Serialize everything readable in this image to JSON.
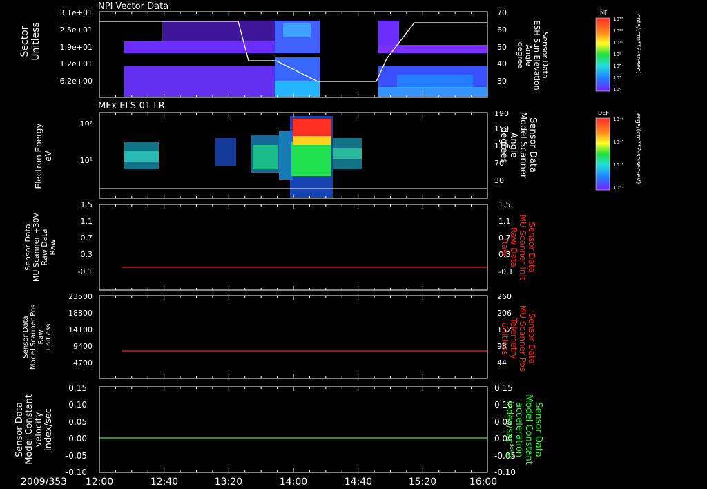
{
  "colors": {
    "white": "#ffffff",
    "red": "#ff2020",
    "green": "#30ff30",
    "bg": "#000000"
  },
  "date_label": "2009/353",
  "time_ticks": [
    "12:00",
    "12:40",
    "13:20",
    "14:00",
    "14:40",
    "15:20",
    "16:00"
  ],
  "chart_data": [
    {
      "type": "heatmap",
      "title": "NPI Vector Data",
      "ylabel": [
        "Sector",
        "Unitless"
      ],
      "y_tick_labels": [
        "3.1e+01",
        "2.5e+01",
        "1.9e+01",
        "1.2e+01",
        "6.2e+00"
      ],
      "right_axis": {
        "label": [
          "Sensor Data",
          "ESH Sun Elevation",
          "Angle",
          "degree"
        ],
        "ticks": [
          70,
          60,
          50,
          40,
          30
        ],
        "ylim": [
          20,
          70
        ]
      },
      "line": {
        "name": "ESH Sun Elevation Angle",
        "x": [
          "12:00",
          "13:10",
          "13:25",
          "13:40",
          "14:10",
          "14:45",
          "15:05",
          "15:20",
          "16:00"
        ],
        "y": [
          66,
          66,
          41,
          41,
          29,
          29,
          40,
          65,
          65
        ]
      },
      "colorbar": {
        "label": "NF",
        "units": "cnts/(cm**2-sr-sec)",
        "ticks": [
          "10¹²",
          "10¹¹",
          "10¹⁰",
          "10⁹",
          "10⁸",
          "10⁷",
          "10⁶"
        ]
      }
    },
    {
      "type": "heatmap",
      "title": "MEx ELS-01 LR",
      "ylabel": [
        "Electron Energy",
        "eV"
      ],
      "y_tick_labels": [
        "10²",
        "10¹"
      ],
      "right_axis": {
        "label": [
          "Sensor Data",
          "Model Scanner",
          "Angle",
          "degrees"
        ],
        "ticks": [
          190,
          150,
          110,
          70,
          30
        ]
      },
      "line": {
        "name": "Model Scanner Angle",
        "x": [
          "12:00",
          "16:00"
        ],
        "y": [
          12,
          12
        ]
      },
      "colorbar": {
        "label": "DEF",
        "units": "ergs/(cm**2-sr-sec-eV)",
        "ticks": [
          "10⁻⁴",
          "10⁻⁵",
          "10⁻⁶",
          "10⁻⁷"
        ]
      }
    },
    {
      "type": "line",
      "ylabel": [
        "Sensor Data",
        "MU Scanner +30V",
        "Raw Data",
        "Raw"
      ],
      "y_ticks": [
        "1.5",
        "1.1",
        "0.7",
        "0.3",
        "-0.1"
      ],
      "ylim": [
        -0.5,
        1.5
      ],
      "right_axis": {
        "label": [
          "Sensor Data",
          "MU Scanner Init",
          "Raw Data",
          "Raw"
        ],
        "ticks": [
          "1.5",
          "1.1",
          "0.7",
          "0.3",
          "-0.1"
        ],
        "color": "#ff2020"
      },
      "series": [
        {
          "color": "#ff2020",
          "x": [
            "12:30",
            "16:00"
          ],
          "y": [
            0,
            0
          ]
        }
      ]
    },
    {
      "type": "line",
      "ylabel": [
        "Sensor Data",
        "Model Scanner Pos",
        "Raw",
        "unitless"
      ],
      "y_ticks": [
        "23500",
        "18800",
        "14100",
        "9400",
        "4700"
      ],
      "ylim": [
        0,
        23500
      ],
      "right_axis": {
        "label": [
          "Sensor Data",
          "MU Scanner Pos",
          "Telemetry",
          "Unitless"
        ],
        "ticks": [
          "260",
          "206",
          "152",
          "98",
          "44"
        ],
        "color": "#ff2020"
      },
      "series": [
        {
          "color": "#ff2020",
          "x": [
            "12:30",
            "16:00"
          ],
          "y": [
            8400,
            8400
          ]
        }
      ]
    },
    {
      "type": "line",
      "ylabel": [
        "Sensor Data",
        "Model Constant",
        "velocity",
        "index/sec"
      ],
      "y_ticks": [
        "0.15",
        "0.10",
        "0.05",
        "0.00",
        "-0.05",
        "-0.10"
      ],
      "ylim": [
        -0.1,
        0.15
      ],
      "right_axis": {
        "label": [
          "Sensor Data",
          "Model Constant",
          "acceleration",
          "index/sec**2"
        ],
        "ticks": [
          "0.15",
          "0.10",
          "0.05",
          "0.00",
          "-0.05",
          "-0.10"
        ],
        "color": "#30ff30"
      },
      "series": [
        {
          "color": "#30ff30",
          "x": [
            "12:00",
            "16:00"
          ],
          "y": [
            0.0,
            0.0
          ]
        }
      ]
    }
  ]
}
